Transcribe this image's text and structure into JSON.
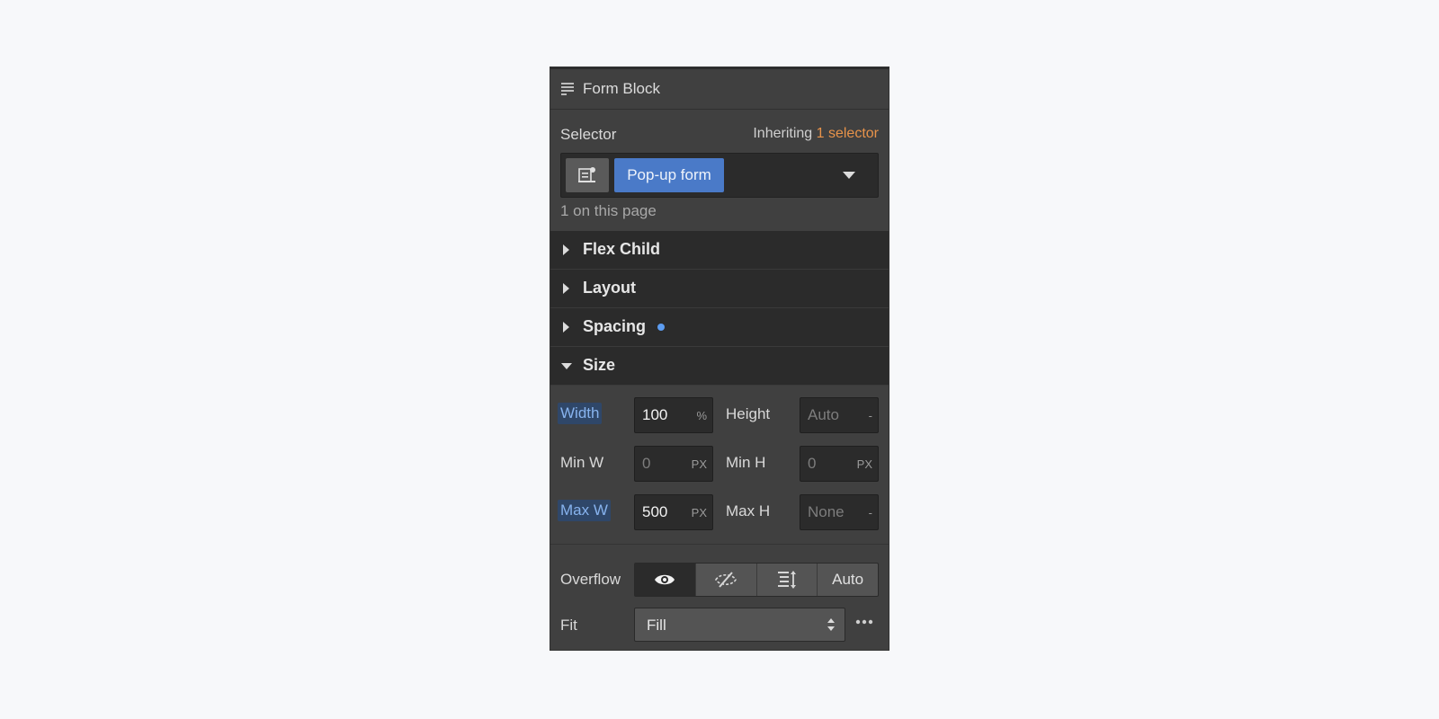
{
  "header": {
    "title": "Form Block",
    "icon": "form-block-icon"
  },
  "selector": {
    "label": "Selector",
    "inherit_prefix": "Inheriting",
    "inherit_count": "1 selector",
    "tag": "Pop-up form",
    "on_page": "1 on this page",
    "accent_color": "#e8934a",
    "tag_color": "#4a7ac8"
  },
  "sections": {
    "flex_child": "Flex Child",
    "layout": "Layout",
    "spacing": "Spacing",
    "size": "Size"
  },
  "size": {
    "width": {
      "label": "Width",
      "value": "100",
      "unit": "%"
    },
    "height": {
      "label": "Height",
      "value": "Auto",
      "unit": "-"
    },
    "min_w": {
      "label": "Min W",
      "value": "0",
      "unit": "PX"
    },
    "min_h": {
      "label": "Min H",
      "value": "0",
      "unit": "PX"
    },
    "max_w": {
      "label": "Max W",
      "value": "500",
      "unit": "PX"
    },
    "max_h": {
      "label": "Max H",
      "value": "None",
      "unit": "-"
    }
  },
  "overflow": {
    "label": "Overflow",
    "options": [
      "visible-eye-icon",
      "hidden-eye-slash-icon",
      "scroll-icon",
      "Auto"
    ],
    "auto_label": "Auto"
  },
  "fit": {
    "label": "Fit",
    "value": "Fill"
  }
}
